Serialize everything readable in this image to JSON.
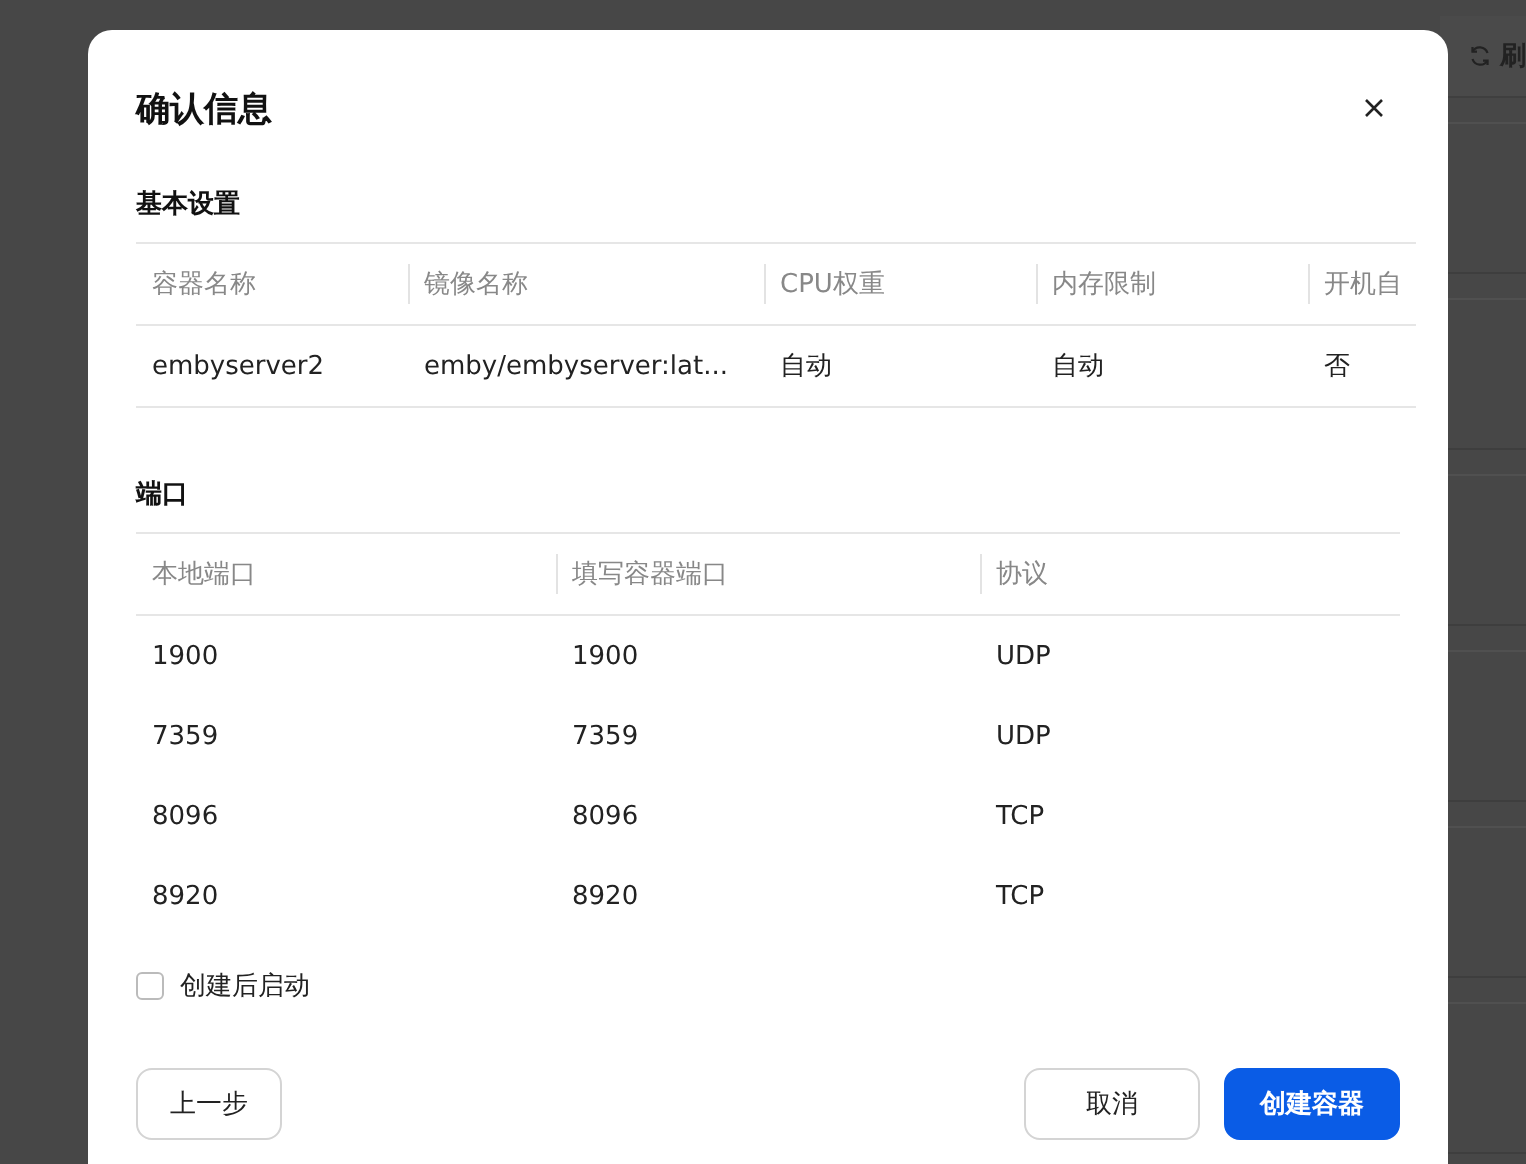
{
  "background": {
    "toolbar_button": "刷"
  },
  "dialog": {
    "title": "确认信息",
    "basic": {
      "title": "基本设置",
      "columns": [
        "容器名称",
        "镜像名称",
        "CPU权重",
        "内存限制",
        "开机自"
      ],
      "rows": [
        [
          "embyserver2",
          "emby/embyserver:lat...",
          "自动",
          "自动",
          "否"
        ]
      ]
    },
    "ports": {
      "title": "端口",
      "columns": [
        "本地端口",
        "填写容器端口",
        "协议"
      ],
      "rows": [
        [
          "1900",
          "1900",
          "UDP"
        ],
        [
          "7359",
          "7359",
          "UDP"
        ],
        [
          "8096",
          "8096",
          "TCP"
        ],
        [
          "8920",
          "8920",
          "TCP"
        ]
      ]
    },
    "start_after_create": {
      "label": "创建后启动",
      "checked": false
    },
    "buttons": {
      "back": "上一步",
      "cancel": "取消",
      "create": "创建容器"
    }
  }
}
